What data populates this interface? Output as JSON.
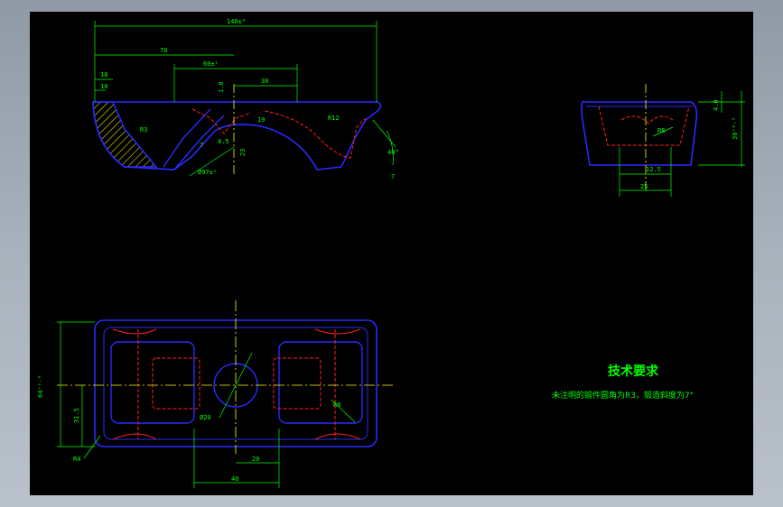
{
  "colors": {
    "background": "#000000",
    "outline": "#2a2aff",
    "hidden_line": "#ff2020",
    "center_line": "#ffff00",
    "dimension": "#00ff00",
    "hatch": "#ffff00",
    "chrome": "#a8b2bc"
  },
  "front_view": {
    "dims": {
      "overall": "140±⁴",
      "d70": "70",
      "d60": "60±¹",
      "d30": "30",
      "d18": "18",
      "d10": "10",
      "d1_8": "1.8",
      "r3": "R3",
      "d7": "7",
      "d4_5": "4.5",
      "dia": "Ø97±¹",
      "d23": "23",
      "d19": "19",
      "r12": "R12",
      "angle": "40°",
      "d7b": "7"
    }
  },
  "side_view": {
    "dims": {
      "r8": "R8",
      "d12_5": "12.5",
      "d25": "25",
      "d4_0": "4.0",
      "h_total": "30⁺⁴·⁵"
    }
  },
  "top_view": {
    "dims": {
      "height_total": "64⁺²·⁰",
      "d31_5": "31.5",
      "dia20": "Ø20",
      "r8": "R8",
      "r4": "R4",
      "d20": "20",
      "d40": "40"
    }
  },
  "tech_requirements": {
    "title": "技术要求",
    "note": "未注明的锻件圆角为R3，锻造斜度为7°"
  }
}
